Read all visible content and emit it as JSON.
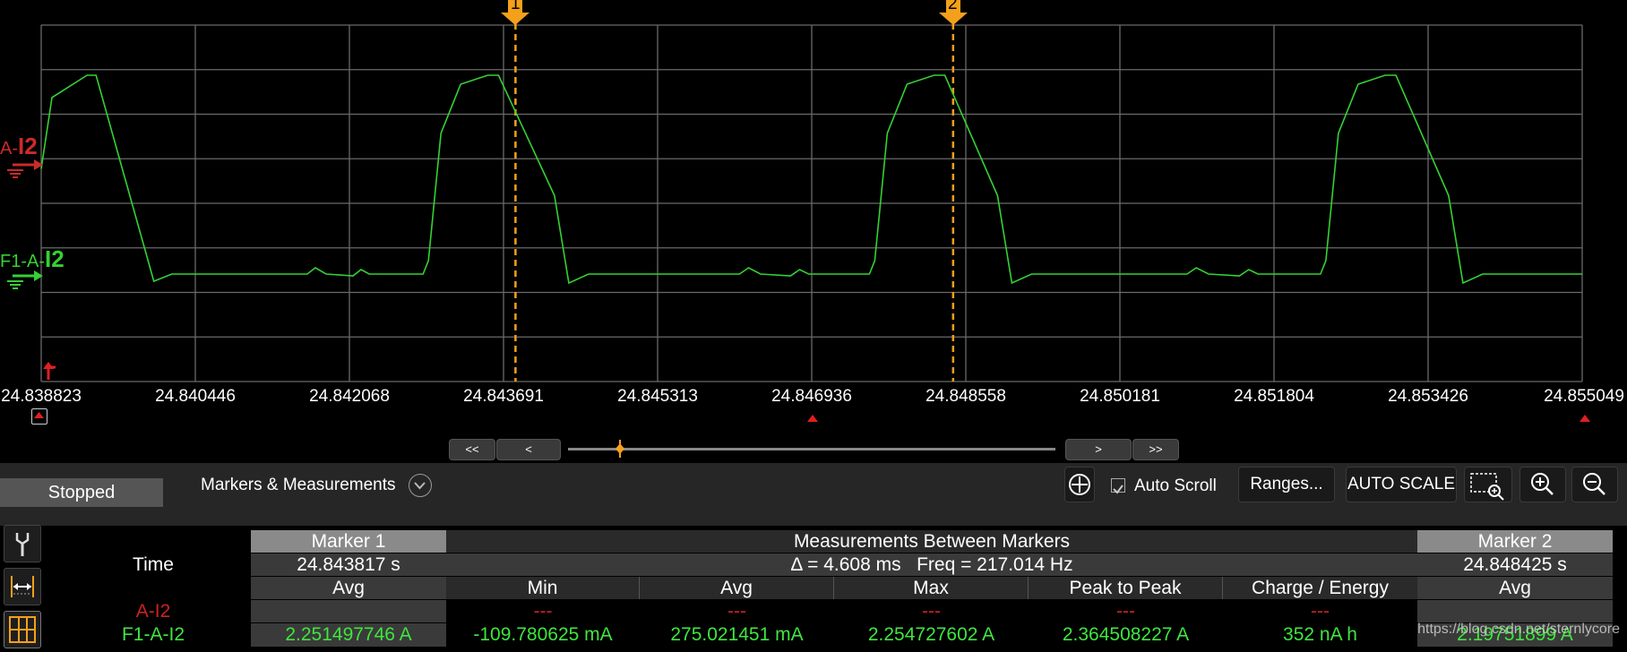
{
  "window": {
    "marker1_flag": "1",
    "marker2_flag": "2"
  },
  "channels": {
    "ch1": {
      "prefix": "A-",
      "name": "I2",
      "color": "#cc2a2a"
    },
    "ch2": {
      "prefix": "F1-A-",
      "name": "I2",
      "color": "#34d134"
    }
  },
  "x_axis": {
    "ticks": [
      "24.838823",
      "24.840446",
      "24.842068",
      "24.843691",
      "24.845313",
      "24.846936",
      "24.848558",
      "24.850181",
      "24.851804",
      "24.853426",
      "24.855049"
    ]
  },
  "chart_data": {
    "type": "line",
    "x_range": [
      24.838823,
      24.855049
    ],
    "markers": [
      24.843817,
      24.848425
    ],
    "series": [
      {
        "name": "F1-A-I2",
        "color": "#34d134",
        "pulse_periods": [
          [
            24.838823,
            24.8394,
            24.840065
          ],
          [
            24.8429,
            24.8436,
            24.844435
          ],
          [
            24.8476,
            24.8483,
            24.8491
          ],
          [
            24.85235,
            24.85305,
            24.85385
          ]
        ],
        "level_units": "A",
        "high_level": 2.25,
        "low_level": 0.02
      }
    ],
    "grid": true
  },
  "scrollbar": {
    "first": "<<",
    "prev": "<",
    "next": ">",
    "last": ">>"
  },
  "toolbar": {
    "status": "Stopped",
    "section_title": "Markers & Measurements",
    "auto_scroll_label": "Auto Scroll",
    "auto_scroll_checked": true,
    "ranges_button": "Ranges...",
    "auto_scale_button": "AUTO SCALE"
  },
  "measurements": {
    "marker1_header": "Marker 1",
    "between_header": "Measurements Between Markers",
    "marker2_header": "Marker 2",
    "time_label": "Time",
    "marker1_time": "24.843817 s",
    "between_time": "Δ = 4.608 ms   Freq = 217.014 Hz",
    "marker2_time": "24.848425 s",
    "col_avg_m1": "Avg",
    "col_min": "Min",
    "col_avg": "Avg",
    "col_max": "Max",
    "col_p2p": "Peak to Peak",
    "col_charge": "Charge / Energy",
    "col_avg_m2": "Avg",
    "rows": [
      {
        "name": "A-I2",
        "m1_avg": "",
        "min": "---",
        "avg": "---",
        "max": "---",
        "p2p": "---",
        "charge": "---",
        "m2_avg": ""
      },
      {
        "name": "F1-A-I2",
        "m1_avg": "2.251497746 A",
        "min": "-109.780625 mA",
        "avg": "275.021451 mA",
        "max": "2.254727602 A",
        "p2p": "2.364508227 A",
        "charge": "352 nA h",
        "m2_avg": "2.19751899 A"
      }
    ]
  },
  "watermark": "https://blog.csdn.net/sternlycore"
}
